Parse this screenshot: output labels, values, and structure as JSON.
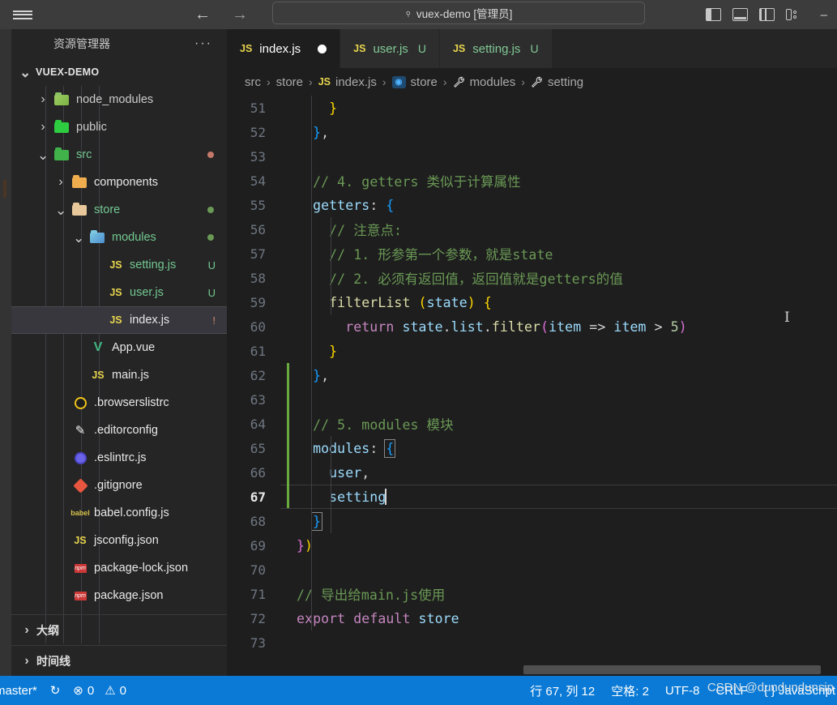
{
  "titlebar": {
    "menu_icon": "hamburger-icon",
    "back_icon": "←",
    "forward_icon": "→",
    "quick_open_text": "vuex-demo [管理员]",
    "search_icon": "⌕",
    "minimize_label": "–",
    "layout_icons": [
      "toggle-primary-sidebar",
      "toggle-panel",
      "toggle-secondary-sidebar",
      "customize-layout"
    ]
  },
  "sidebar": {
    "title": "资源管理器",
    "more_actions": "···",
    "root_label": "VUEX-DEMO",
    "tree": [
      {
        "label": "node_modules",
        "kind": "folder",
        "icon": "folder-node-modules-icon",
        "indent": 1,
        "expanded": false,
        "color": "#cccccc",
        "badge": "",
        "dot": ""
      },
      {
        "label": "public",
        "kind": "folder",
        "icon": "folder-public-icon",
        "indent": 1,
        "expanded": false,
        "color": "#cccccc",
        "badge": "",
        "dot": ""
      },
      {
        "label": "src",
        "kind": "folder",
        "icon": "folder-src-icon",
        "indent": 1,
        "expanded": true,
        "color": "#73c991",
        "badge": "",
        "dot": "#c4786a"
      },
      {
        "label": "components",
        "kind": "folder",
        "icon": "folder-components-icon",
        "indent": 2,
        "expanded": false,
        "color": "#e8e8e8",
        "badge": "",
        "dot": ""
      },
      {
        "label": "store",
        "kind": "folder",
        "icon": "folder-store-icon",
        "indent": 2,
        "expanded": true,
        "color": "#73c991",
        "badge": "",
        "dot": "#6a9955"
      },
      {
        "label": "modules",
        "kind": "folder",
        "icon": "folder-modules-icon",
        "indent": 3,
        "expanded": true,
        "color": "#73c991",
        "badge": "",
        "dot": "#6a9955"
      },
      {
        "label": "setting.js",
        "kind": "file-js",
        "icon": "js-file-icon",
        "indent": 4,
        "expanded": null,
        "color": "#73c991",
        "badge": "U",
        "dot": ""
      },
      {
        "label": "user.js",
        "kind": "file-js",
        "icon": "js-file-icon",
        "indent": 4,
        "expanded": null,
        "color": "#73c991",
        "badge": "U",
        "dot": ""
      },
      {
        "label": "index.js",
        "kind": "file-js",
        "icon": "js-file-icon",
        "indent": 4,
        "expanded": null,
        "color": "#e8e8e8",
        "badge": "!",
        "dot": "",
        "selected": true
      },
      {
        "label": "App.vue",
        "kind": "file-vue",
        "icon": "vue-file-icon",
        "indent": 3,
        "expanded": null,
        "color": "#e8e8e8",
        "badge": "",
        "dot": ""
      },
      {
        "label": "main.js",
        "kind": "file-js",
        "icon": "js-file-icon",
        "indent": 3,
        "expanded": null,
        "color": "#e8e8e8",
        "badge": "",
        "dot": ""
      },
      {
        "label": ".browserslistrc",
        "kind": "file-misc",
        "icon": "browserslist-icon",
        "indent": 2,
        "expanded": null,
        "color": "#e8e8e8",
        "badge": "",
        "dot": ""
      },
      {
        "label": ".editorconfig",
        "kind": "file-misc",
        "icon": "editorconfig-icon",
        "indent": 2,
        "expanded": null,
        "color": "#e8e8e8",
        "badge": "",
        "dot": ""
      },
      {
        "label": ".eslintrc.js",
        "kind": "file-misc",
        "icon": "eslint-icon",
        "indent": 2,
        "expanded": null,
        "color": "#e8e8e8",
        "badge": "",
        "dot": ""
      },
      {
        "label": ".gitignore",
        "kind": "file-misc",
        "icon": "git-icon",
        "indent": 2,
        "expanded": null,
        "color": "#e8e8e8",
        "badge": "",
        "dot": ""
      },
      {
        "label": "babel.config.js",
        "kind": "file-misc",
        "icon": "babel-icon",
        "indent": 2,
        "expanded": null,
        "color": "#e8e8e8",
        "badge": "",
        "dot": ""
      },
      {
        "label": "jsconfig.json",
        "kind": "file-js",
        "icon": "js-file-icon",
        "indent": 2,
        "expanded": null,
        "color": "#e8e8e8",
        "badge": "",
        "dot": ""
      },
      {
        "label": "package-lock.json",
        "kind": "file-misc",
        "icon": "npm-icon",
        "indent": 2,
        "expanded": null,
        "color": "#e8e8e8",
        "badge": "",
        "dot": ""
      },
      {
        "label": "package.json",
        "kind": "file-misc",
        "icon": "npm-icon",
        "indent": 2,
        "expanded": null,
        "color": "#e8e8e8",
        "badge": "",
        "dot": ""
      }
    ],
    "sections": [
      {
        "label": "大纲"
      },
      {
        "label": "时间线"
      }
    ]
  },
  "tabs": [
    {
      "label": "index.js",
      "icon": "js-file-icon",
      "active": true,
      "dirty": true,
      "badge": ""
    },
    {
      "label": "user.js",
      "icon": "js-file-icon",
      "active": false,
      "dirty": false,
      "badge": "U"
    },
    {
      "label": "setting.js",
      "icon": "js-file-icon",
      "active": false,
      "dirty": false,
      "badge": "U"
    }
  ],
  "breadcrumb": [
    {
      "label": "src",
      "icon": ""
    },
    {
      "label": "store",
      "icon": ""
    },
    {
      "label": "index.js",
      "icon": "js-file-icon"
    },
    {
      "label": "store",
      "icon": "variable-icon"
    },
    {
      "label": "modules",
      "icon": "wrench-icon"
    },
    {
      "label": "setting",
      "icon": "wrench-icon"
    }
  ],
  "editor": {
    "first_line": 51,
    "lines": [
      {
        "n": 51,
        "text": "    }",
        "changed": false
      },
      {
        "n": 52,
        "text": "  },",
        "changed": false
      },
      {
        "n": 53,
        "text": "",
        "changed": false
      },
      {
        "n": 54,
        "text": "  // 4. getters 类似于计算属性",
        "changed": false
      },
      {
        "n": 55,
        "text": "  getters: {",
        "changed": false
      },
      {
        "n": 56,
        "text": "    // 注意点:",
        "changed": false
      },
      {
        "n": 57,
        "text": "    // 1. 形参第一个参数，就是state",
        "changed": false
      },
      {
        "n": 58,
        "text": "    // 2. 必须有返回值，返回值就是getters的值",
        "changed": false
      },
      {
        "n": 59,
        "text": "    filterList (state) {",
        "changed": false
      },
      {
        "n": 60,
        "text": "      return state.list.filter(item => item > 5)",
        "changed": false
      },
      {
        "n": 61,
        "text": "    }",
        "changed": false
      },
      {
        "n": 62,
        "text": "  },",
        "changed": true
      },
      {
        "n": 63,
        "text": "",
        "changed": true
      },
      {
        "n": 64,
        "text": "  // 5. modules 模块",
        "changed": true
      },
      {
        "n": 65,
        "text": "  modules: {",
        "changed": true
      },
      {
        "n": 66,
        "text": "    user,",
        "changed": true
      },
      {
        "n": 67,
        "text": "    setting",
        "changed": true,
        "active": true
      },
      {
        "n": 68,
        "text": "  }",
        "changed": false
      },
      {
        "n": 69,
        "text": "})",
        "changed": false
      },
      {
        "n": 70,
        "text": "",
        "changed": false
      },
      {
        "n": 71,
        "text": "// 导出给main.js使用",
        "changed": false
      },
      {
        "n": 72,
        "text": "export default store",
        "changed": false
      },
      {
        "n": 73,
        "text": "",
        "changed": false
      }
    ]
  },
  "statusbar": {
    "branch": "master*",
    "sync_icon": "↻",
    "errors_icon": "⊗",
    "errors": "0",
    "warnings_icon": "⚠",
    "warnings": "0",
    "position": "行 67, 列 12",
    "indentation": "空格: 2",
    "encoding": "UTF-8",
    "eol": "CRLF",
    "language": "{ } JavaScript",
    "watermark": "CSDN @dundundunsip"
  },
  "colors": {
    "accent": "#0a7ad6",
    "editor_bg": "#1e1e1e",
    "sidebar_bg": "#252526",
    "titlebar_bg": "#3c3c3c",
    "comment": "#6a9955",
    "keyword": "#c586c0",
    "property": "#9cdcfe",
    "function": "#dcdcaa",
    "number": "#b5cea8",
    "git_modified": "#6aab3e",
    "untracked": "#73c991"
  }
}
